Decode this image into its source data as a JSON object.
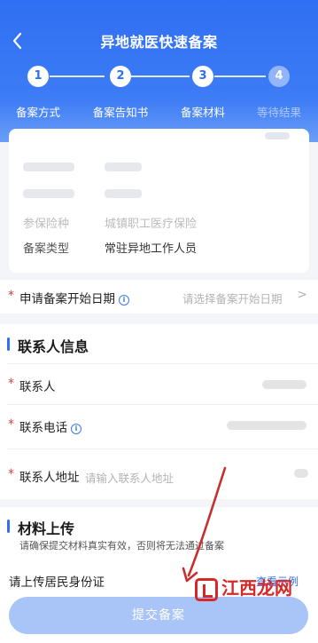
{
  "header": {
    "title": "异地就医快速备案",
    "steps": [
      {
        "number": "1",
        "label": "备案方式",
        "state": "done"
      },
      {
        "number": "2",
        "label": "备案告知书",
        "state": "done"
      },
      {
        "number": "3",
        "label": "备案材料",
        "state": "current"
      },
      {
        "number": "4",
        "label": "等待结果",
        "state": "pending"
      }
    ]
  },
  "info_card": {
    "rows": [
      {
        "label": "参保险种",
        "value": "城镇职工医疗保险"
      },
      {
        "label": "备案类型",
        "value": "常驻异地工作人员"
      }
    ]
  },
  "date_row": {
    "required_mark": "*",
    "label": "申请备案开始日期",
    "placeholder": "请选择备案开始日期",
    "chevron": ">"
  },
  "contact": {
    "title": "联系人信息",
    "rows": [
      {
        "label": "联系人",
        "required_mark": "*"
      },
      {
        "label": "联系电话",
        "required_mark": "*"
      },
      {
        "label": "联系人地址",
        "required_mark": "*",
        "placeholder": "请输入联系人地址"
      }
    ]
  },
  "upload": {
    "title": "材料上传",
    "hint": "请确保提交材料真实有效，否则将无法通过备案",
    "item_label": "请上传居民身份证",
    "example_link": "查看示例"
  },
  "submit": {
    "label": "提交备案"
  },
  "watermark": {
    "text": "江西龙网"
  },
  "colors": {
    "primary": "#2f6ff2",
    "required": "#e23b3b",
    "annotation_arrow": "#c62f2f"
  },
  "icons": {
    "back": "chevron-left-icon",
    "info": "info-icon",
    "chevron": "chevron-right-icon"
  }
}
